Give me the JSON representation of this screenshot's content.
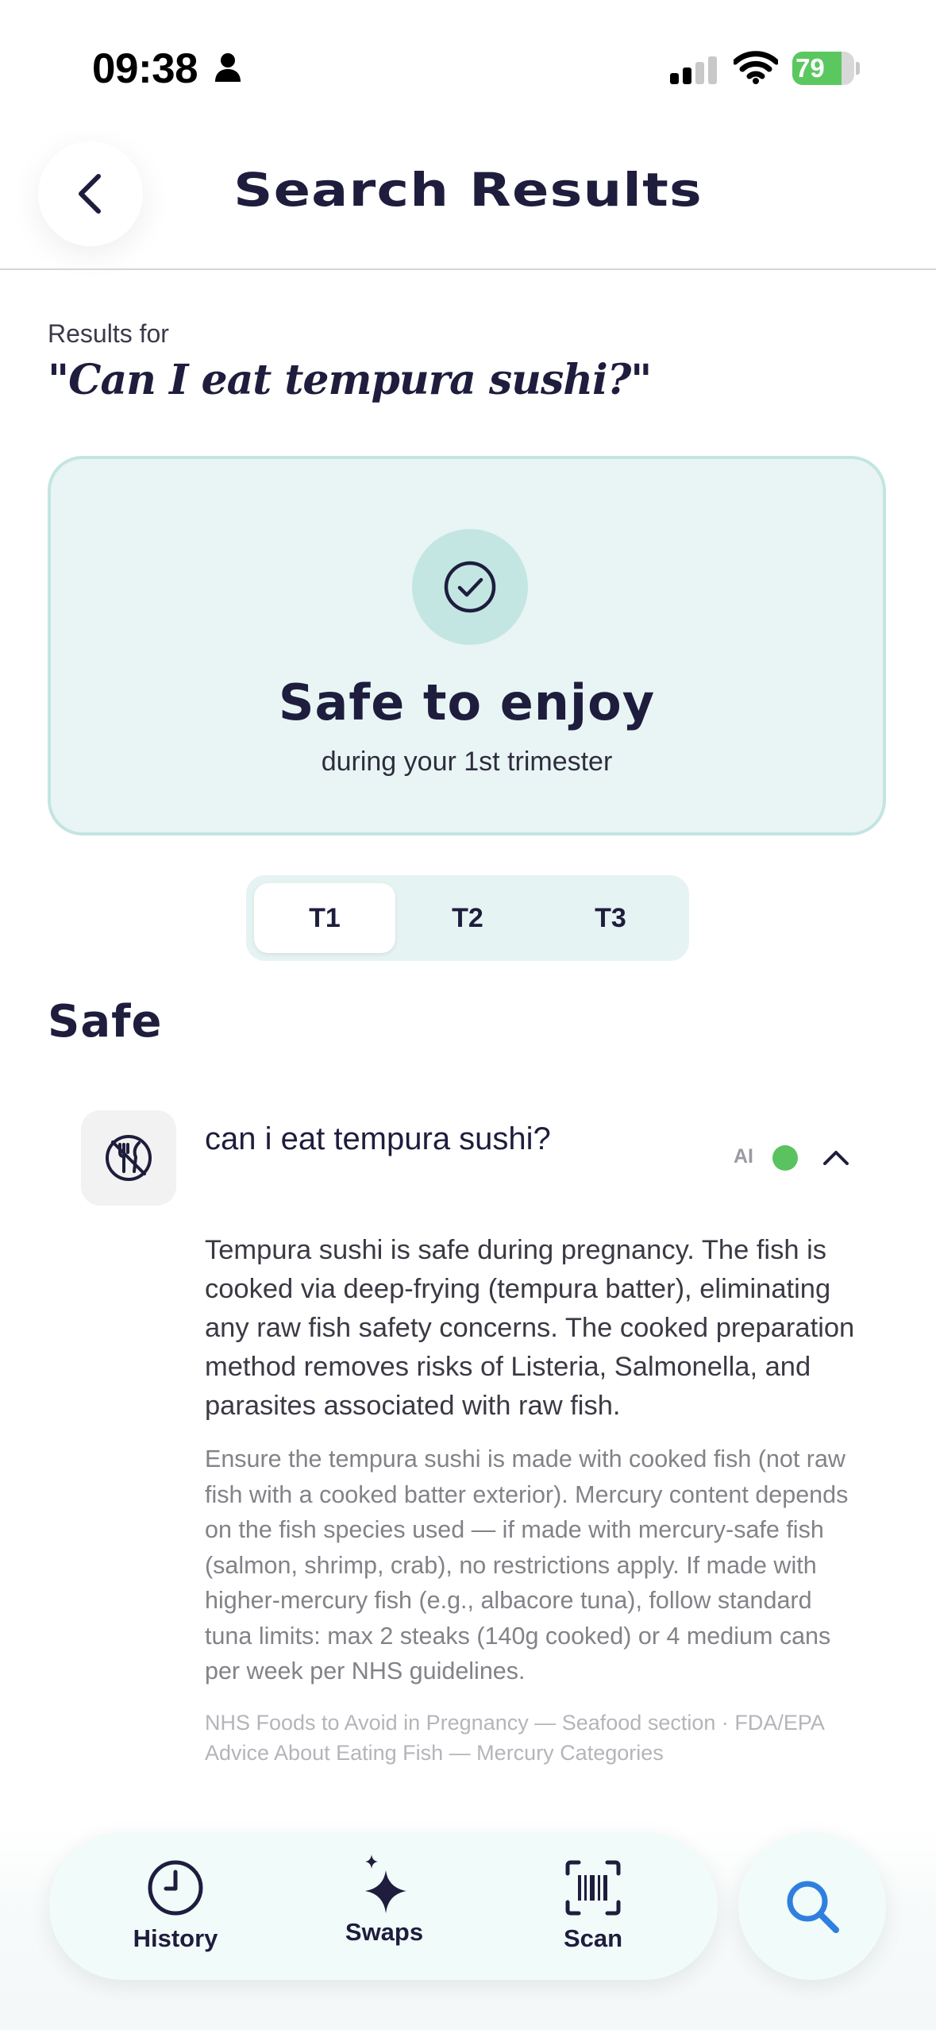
{
  "status_bar": {
    "time": "09:38",
    "battery": "79",
    "battery_level": 0.79
  },
  "header": {
    "title": "Search Results",
    "back_icon": "chevron-left-icon"
  },
  "results": {
    "label": "Results for",
    "query": "\"Can I eat tempura sushi?\""
  },
  "verdict": {
    "icon": "check-circle-icon",
    "title": "Safe to enjoy",
    "subtitle": "during your 1st trimester"
  },
  "tabs": [
    {
      "label": "T1",
      "active": true
    },
    {
      "label": "T2",
      "active": false
    },
    {
      "label": "T3",
      "active": false
    }
  ],
  "section": {
    "heading": "Safe"
  },
  "result_item": {
    "icon": "no-utensils-icon",
    "question": "can i eat tempura sushi?",
    "ai_label": "AI",
    "status_color": "#5ac25e",
    "summary": "Tempura sushi is safe during pregnancy. The fish is cooked via deep-frying (tempura batter), eliminating any raw fish safety concerns. The cooked preparation method removes risks of Listeria, Salmonella, and parasites associated with raw fish.",
    "detail": "Ensure the tempura sushi is made with cooked fish (not raw fish with a cooked batter exterior). Mercury content depends on the fish species used — if made with mercury-safe fish (salmon, shrimp, crab), no restrictions apply. If made with higher-mercury fish (e.g., albacore tuna), follow standard tuna limits: max 2 steaks (140g cooked) or 4 medium cans per week per NHS guidelines.",
    "sources": "NHS Foods to Avoid in Pregnancy — Seafood section · FDA/EPA Advice About Eating Fish — Mercury Categories"
  },
  "bottom_nav": {
    "items": [
      {
        "label": "History",
        "icon": "clock-icon"
      },
      {
        "label": "Swaps",
        "icon": "sparkle-icon"
      },
      {
        "label": "Scan",
        "icon": "barcode-scan-icon"
      }
    ],
    "search_icon": "search-icon"
  },
  "colors": {
    "primary_text": "#1e1d3d",
    "card_background": "#e8f5f4",
    "card_border": "#c3e5e2",
    "accent_blue": "#2f7fe0",
    "safe_green": "#5ac25e"
  }
}
